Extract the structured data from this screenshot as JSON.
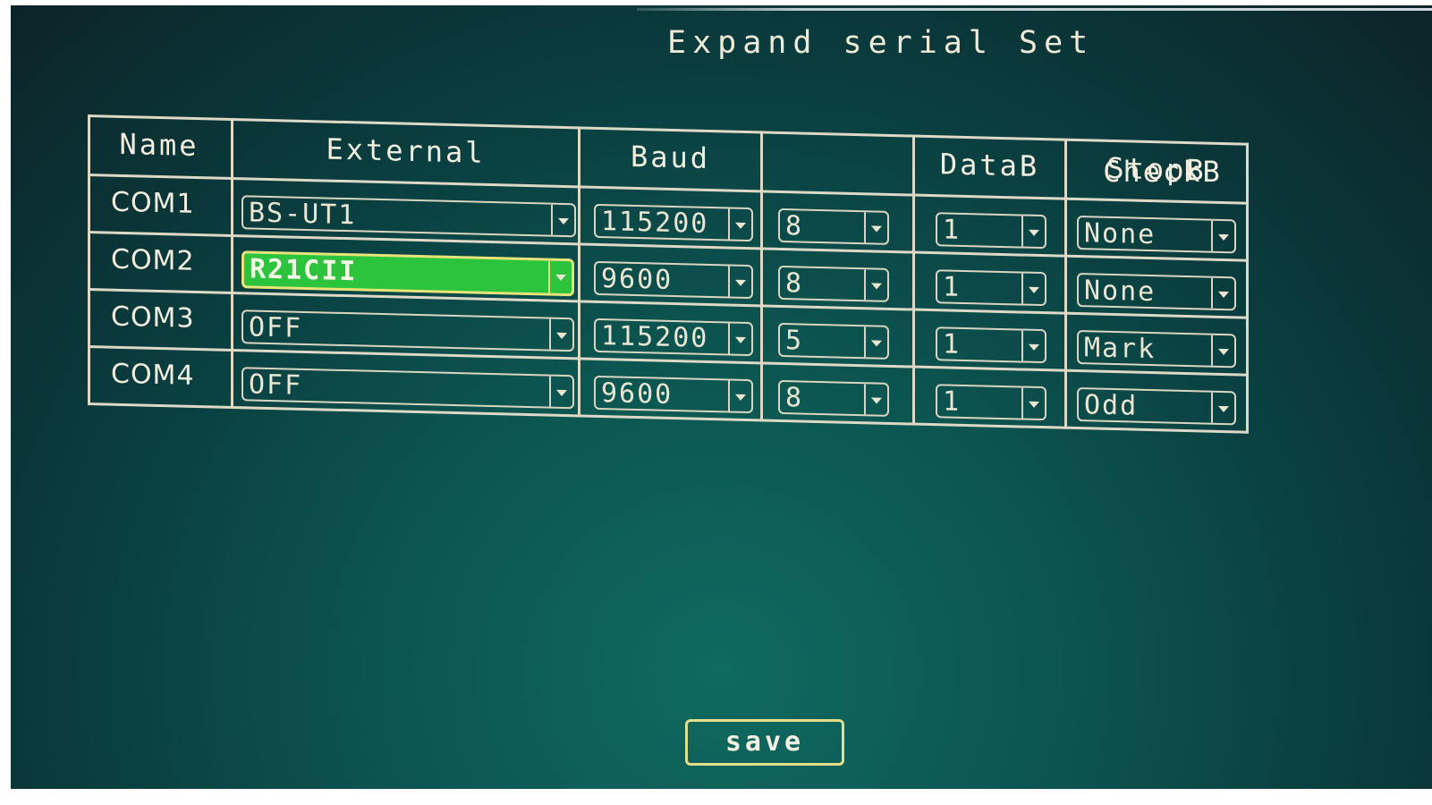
{
  "title": "Expand serial Set",
  "columns": [
    "Name",
    "External",
    "Baud",
    "DataB",
    "StopB",
    "CheckB"
  ],
  "rows": [
    {
      "name": "COM1",
      "external": "BS-UT1",
      "baud": "115200",
      "datab": "8",
      "stopb": "1",
      "checkb": "None"
    },
    {
      "name": "COM2",
      "external": "R21CII",
      "baud": "9600",
      "datab": "8",
      "stopb": "1",
      "checkb": "None"
    },
    {
      "name": "COM3",
      "external": "OFF",
      "baud": "115200",
      "datab": "5",
      "stopb": "1",
      "checkb": "Mark"
    },
    {
      "name": "COM4",
      "external": "OFF",
      "baud": "9600",
      "datab": "8",
      "stopb": "1",
      "checkb": "Odd"
    }
  ],
  "selected_field": "COM2 External",
  "save_label": "save",
  "colors": {
    "background": "#0c5450",
    "selected_field": "#2cc43c",
    "selected_border": "#e8e47a",
    "text": "#f3eede"
  },
  "icons": {
    "dropdown": "chevron-down-icon"
  }
}
